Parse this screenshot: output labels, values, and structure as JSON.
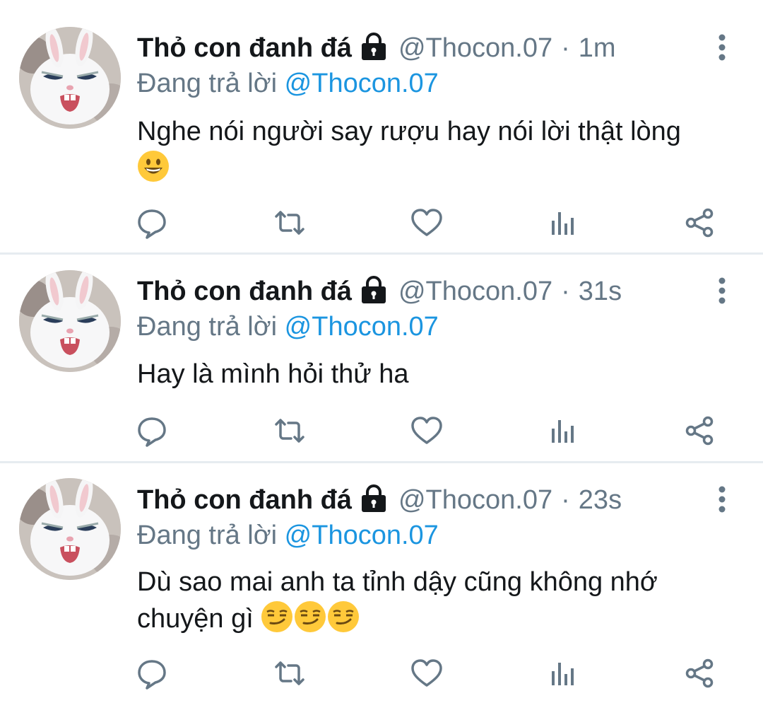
{
  "tweets": [
    {
      "display_name": "Thỏ con đanh đá",
      "handle": "@Thocon.07",
      "separator": "·",
      "time": "1m",
      "replying_label": "Đang trả lời",
      "replying_to": "@Thocon.07",
      "text_line1": "Nghe nói người say rượu hay nói lời thật lòng",
      "text_line2": "",
      "emoji": [
        "grinning-face"
      ]
    },
    {
      "display_name": "Thỏ con đanh đá",
      "handle": "@Thocon.07",
      "separator": "·",
      "time": "31s",
      "replying_label": "Đang trả lời",
      "replying_to": "@Thocon.07",
      "text_line1": "Hay là mình hỏi thử ha",
      "text_line2": "",
      "emoji": []
    },
    {
      "display_name": "Thỏ con đanh đá",
      "handle": "@Thocon.07",
      "separator": "·",
      "time": "23s",
      "replying_label": "Đang trả lời",
      "replying_to": "@Thocon.07",
      "text_line1": "Dù sao mai anh ta tỉnh dậy cũng không nhớ",
      "text_line2": "chuyện gì",
      "emoji": [
        "smirking-face",
        "smirking-face",
        "smirking-face"
      ]
    }
  ],
  "icons": {
    "protected": "lock-icon",
    "more": "more-vertical-icon",
    "actions": [
      "reply-icon",
      "retweet-icon",
      "like-icon",
      "analytics-icon",
      "share-icon"
    ]
  },
  "colors": {
    "name": "#14171a",
    "secondary": "#657786",
    "link": "#1b95e0",
    "divider": "#e6ecf0",
    "emoji": "#ffc93a"
  }
}
